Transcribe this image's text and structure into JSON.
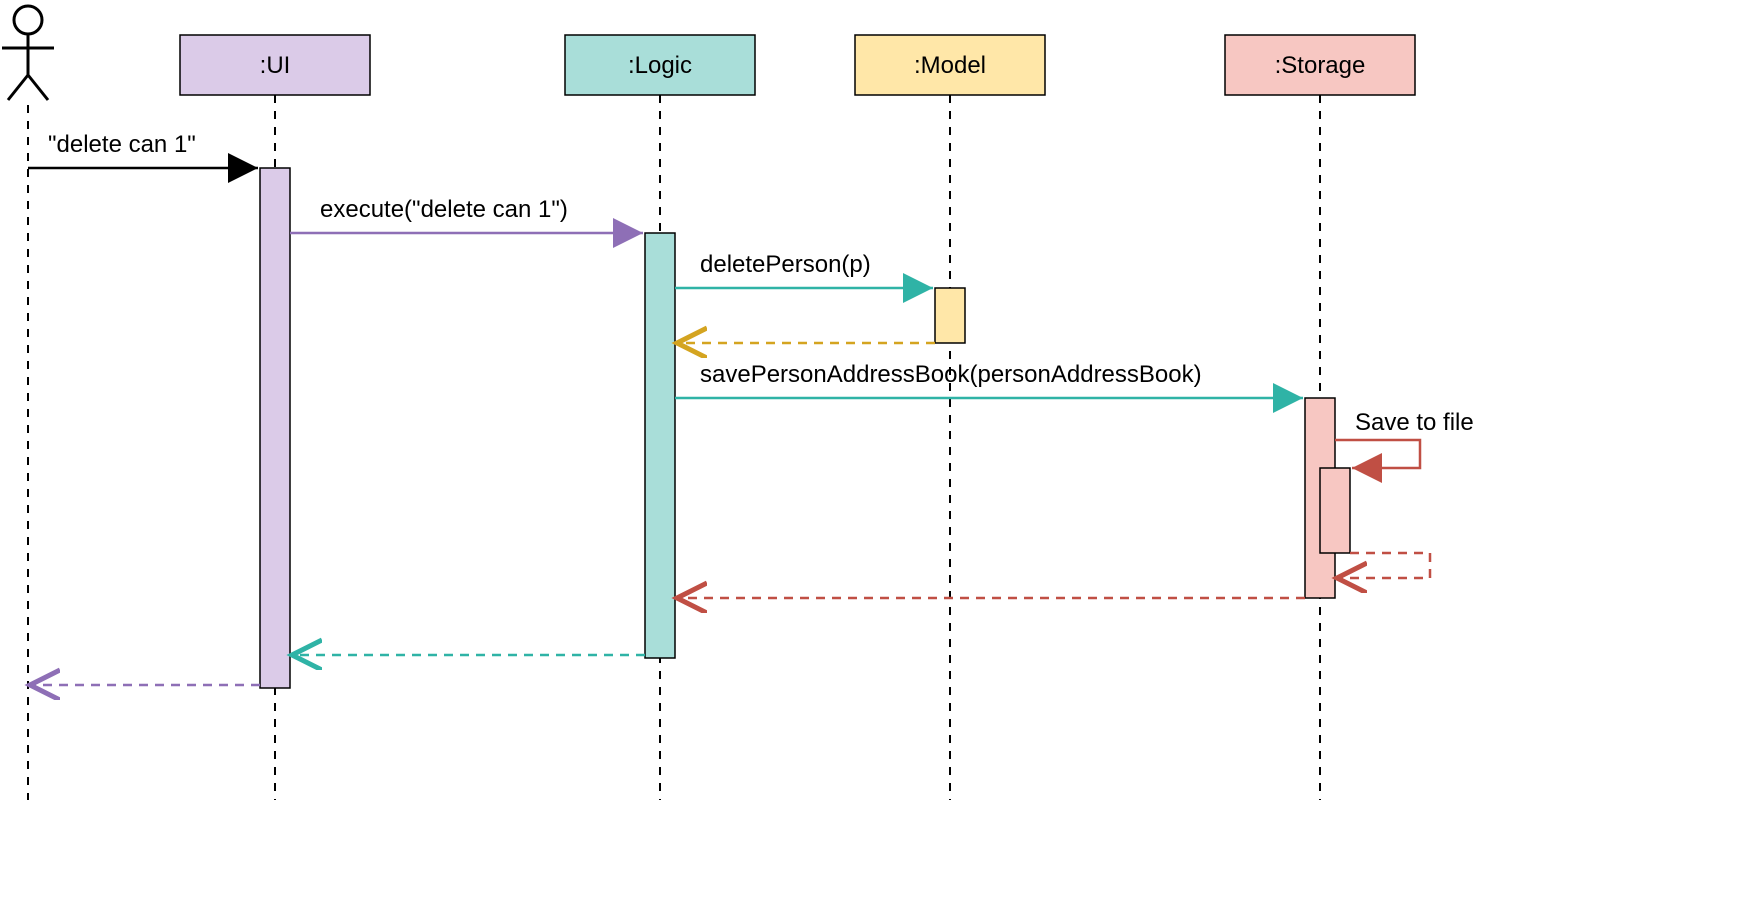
{
  "diagram_type": "UML Sequence Diagram",
  "actors": [
    {
      "id": "actor",
      "label": "",
      "type": "human"
    }
  ],
  "participants": [
    {
      "id": "ui",
      "label": ":UI",
      "fill": "#dbcbe8",
      "stroke": "#8e6fb6"
    },
    {
      "id": "logic",
      "label": ":Logic",
      "fill": "#a9ded9",
      "stroke": "#2fb3a6"
    },
    {
      "id": "model",
      "label": ":Model",
      "fill": "#ffe7a8",
      "stroke": "#d4a420"
    },
    {
      "id": "storage",
      "label": ":Storage",
      "fill": "#f7c7c2",
      "stroke": "#c04f44"
    }
  ],
  "messages": {
    "m1": "\"delete can 1\"",
    "m2": "execute(\"delete can 1\")",
    "m3": "deletePerson(p)",
    "m4": "savePersonAddressBook(personAddressBook)",
    "m5": "Save to file"
  },
  "colors": {
    "ui": "#8e6fb6",
    "logic": "#2fb3a6",
    "model": "#d4a420",
    "storage": "#c04f44",
    "black": "#000000"
  }
}
